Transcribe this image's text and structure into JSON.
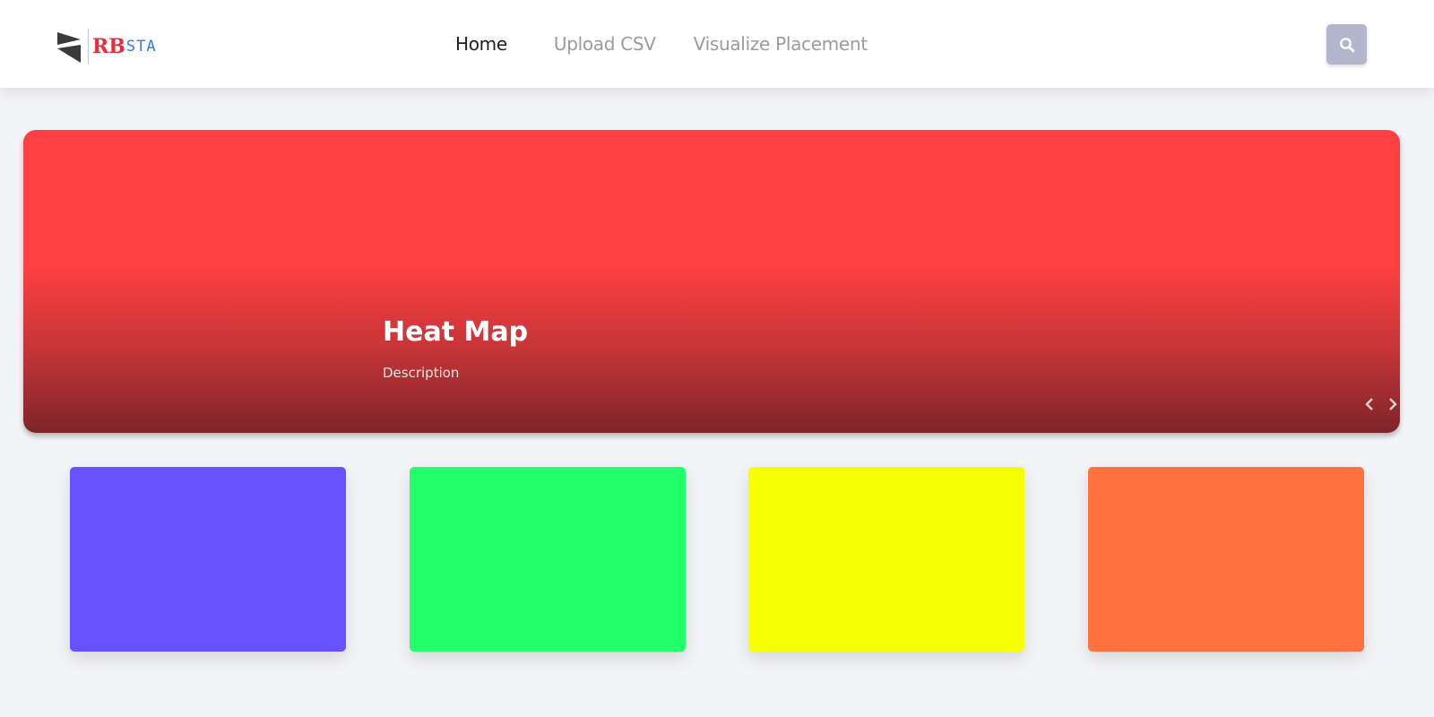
{
  "brand": {
    "name_part1": "RB",
    "name_part2": "STA",
    "icon": "logo-flag-icon",
    "colors": {
      "part1": "#ee2b3a",
      "part2": "#2a7df0",
      "mark": "#3a3a3a"
    }
  },
  "nav": {
    "items": [
      {
        "label": "Home",
        "active": true
      },
      {
        "label": "Upload CSV",
        "active": false
      },
      {
        "label": "Visualize Placement",
        "active": false
      }
    ],
    "search_icon": "search-icon"
  },
  "hero": {
    "title": "Heat Map",
    "description": "Description",
    "prev_icon": "chevron-left-icon",
    "next_icon": "chevron-right-icon",
    "colors": {
      "top": "#ff4042",
      "bottom": "#7e242a"
    }
  },
  "cards": [
    {
      "color": "#6852ff"
    },
    {
      "color": "#23ff6a"
    },
    {
      "color": "#f6ff03"
    },
    {
      "color": "#ff713e"
    }
  ],
  "colors": {
    "background": "#f3f4f8",
    "search_button": "#b3b6cc"
  }
}
